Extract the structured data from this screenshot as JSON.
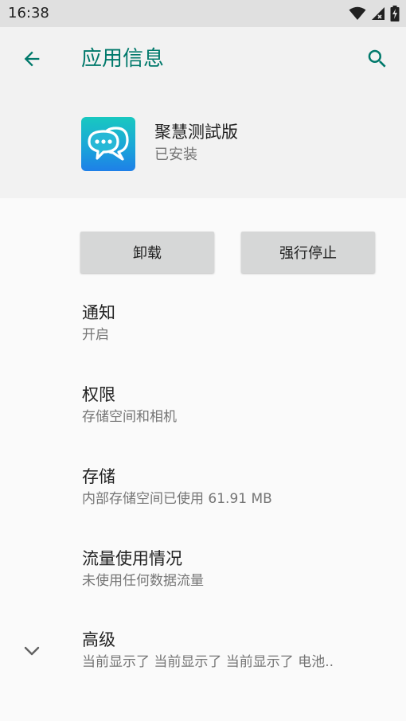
{
  "status_bar": {
    "time": "16:38",
    "icons": [
      "wifi-icon",
      "signal-icon",
      "battery-charging-icon"
    ]
  },
  "header": {
    "title": "应用信息",
    "back_icon": "arrow-back-icon",
    "search_icon": "search-icon"
  },
  "app": {
    "name": "聚慧测試版",
    "status": "已安装",
    "icon": "chat-bubbles-icon",
    "icon_colors": [
      "#19c8c0",
      "#1e7fe8"
    ]
  },
  "actions": {
    "uninstall_label": "卸载",
    "force_stop_label": "强行停止"
  },
  "settings": [
    {
      "title": "通知",
      "summary": "开启"
    },
    {
      "title": "权限",
      "summary": "存储空间和相机"
    },
    {
      "title": "存储",
      "summary": "内部存储空间已使用 61.91 MB"
    },
    {
      "title": "流量使用情况",
      "summary": "未使用任何数据流量"
    },
    {
      "title": "高级",
      "summary": "当前显示了 当前显示了 当前显示了 电池.."
    }
  ],
  "colors": {
    "accent": "#00796b",
    "header_bg": "#f2f2f2",
    "button_bg": "#d6d7d7"
  }
}
